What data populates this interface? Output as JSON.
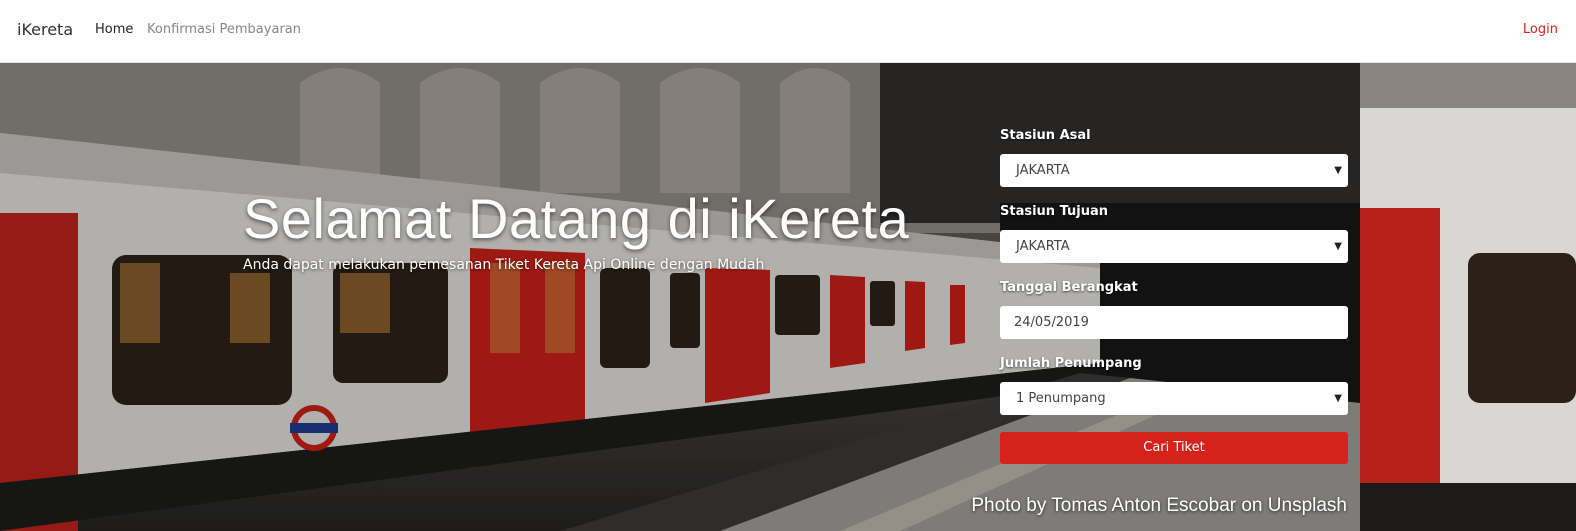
{
  "navbar": {
    "brand": "iKereta",
    "links": [
      "Home",
      "Konfirmasi Pembayaran"
    ],
    "login": "Login",
    "login_color": "#d9221b"
  },
  "hero": {
    "title": "Selamat Datang di iKereta",
    "subtitle": "Anda dapat melakukan pemesanan Tiket Kereta Api Online dengan Mudah",
    "photo_credit": "Photo by Tomas Anton Escobar on Unsplash",
    "accent_color": "#d5221b"
  },
  "form": {
    "origin_label": "Stasiun Asal",
    "origin_value": "JAKARTA",
    "destination_label": "Stasiun Tujuan",
    "destination_value": "JAKARTA",
    "date_label": "Tanggal Berangkat",
    "date_value": "24/05/2019",
    "passengers_label": "Jumlah Penumpang",
    "passengers_value": "1 Penumpang",
    "submit_label": "Cari Tiket"
  }
}
